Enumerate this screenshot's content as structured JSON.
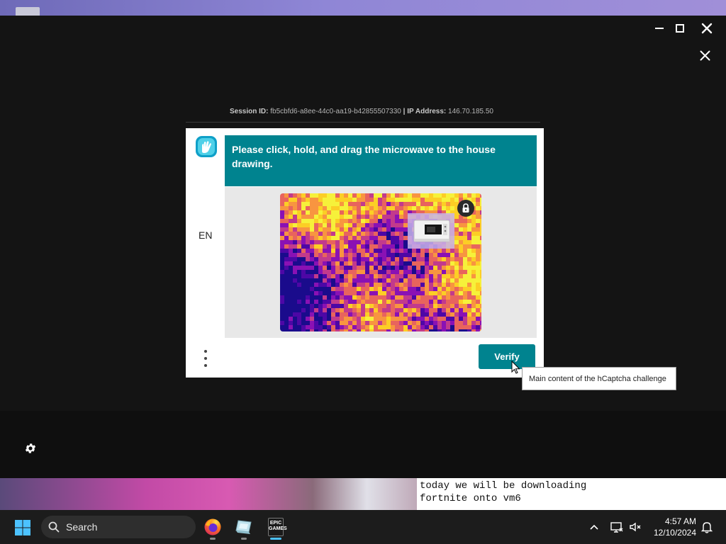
{
  "captcha": {
    "session_label": "Session ID:",
    "session_id": "fb5cbfd6-a8ee-44c0-aa19-b42855507330",
    "ip_label": "| IP Address:",
    "ip_address": "146.70.185.50",
    "prompt": "Please click, hold, and drag the microwave to the house drawing.",
    "language": "EN",
    "verify_label": "Verify",
    "tooltip": "Main content of the hCaptcha challenge",
    "accent_color": "#00838f"
  },
  "stream": {
    "caption_line1": "today we will be downloading",
    "caption_line2": "fortnite onto vm6"
  },
  "taskbar": {
    "search_label": "Search",
    "apps": [
      "firefox-icon",
      "app-icon",
      "epic-games-icon"
    ],
    "epic_logo_text": "EPIC GAMES",
    "time": "4:57 AM",
    "date": "12/10/2024"
  }
}
